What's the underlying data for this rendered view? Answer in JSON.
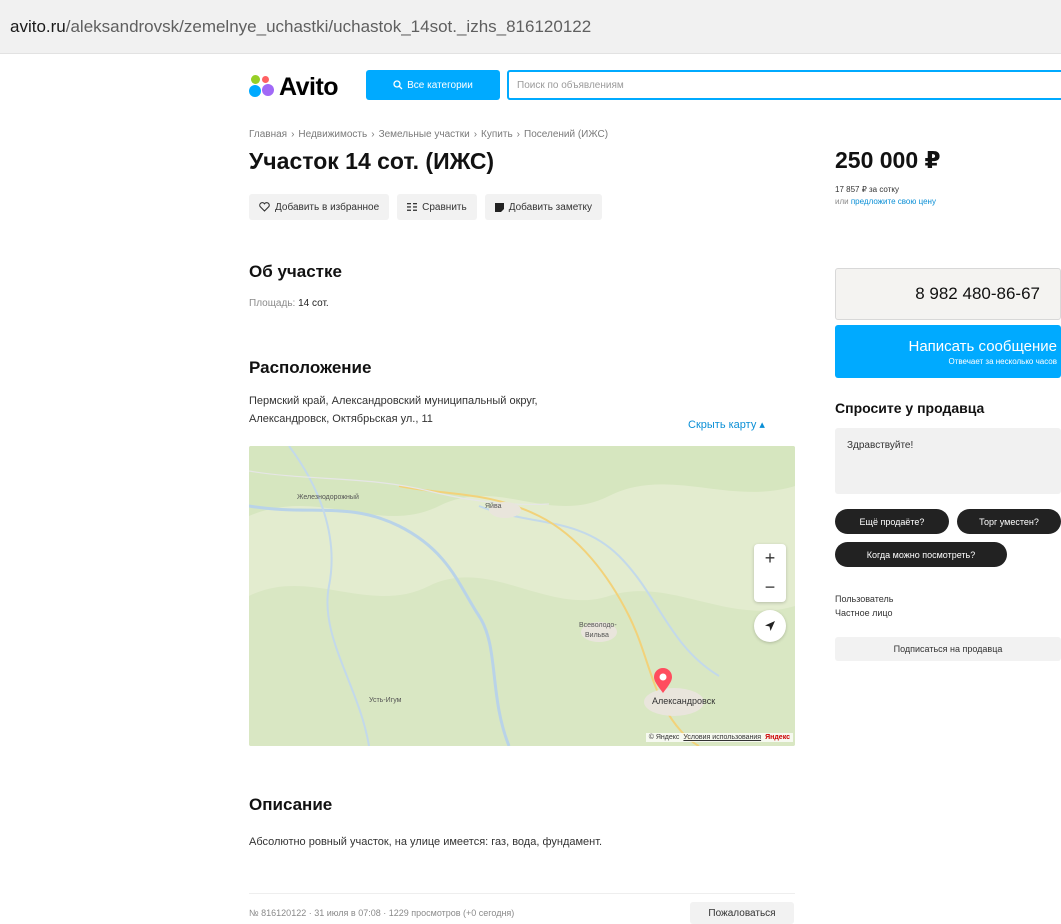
{
  "browser": {
    "url_domain": "avito.ru",
    "url_path": "/aleksandrovsk/zemelnye_uchastki/uchastok_14sot._izhs_816120122"
  },
  "header": {
    "logo_text": "Avito",
    "categories_label": "Все категории",
    "search_placeholder": "Поиск по объявлениям"
  },
  "breadcrumbs": [
    "Главная",
    "›",
    "Недвижимость",
    "›",
    "Земельные участки",
    "›",
    "Купить",
    "›",
    "Поселений (ИЖС)"
  ],
  "listing": {
    "title": "Участок 14 сот. (ИЖС)",
    "actions": {
      "favorite": "Добавить в избранное",
      "compare": "Сравнить",
      "note": "Добавить заметку"
    },
    "about_heading": "Об участке",
    "area_key": "Площадь:",
    "area_value": "14 сот.",
    "location_heading": "Расположение",
    "address_line1": "Пермский край, Александровский муниципальный округ,",
    "address_line2": "Александровск, Октябрьская ул., 11",
    "hide_map": "Скрыть карту ▴",
    "description_heading": "Описание",
    "description": "Абсолютно ровный участок, на улице имеется: газ, вода, фундамент."
  },
  "map": {
    "places": {
      "p1": "Железнодорожный",
      "p2": "Яйва",
      "p3": "Всеволодо-",
      "p3b": "Вильва",
      "p4": "Усть-Игум",
      "p5": "Александровск"
    },
    "zoom_in": "+",
    "zoom_out": "−",
    "copyright": "© Яндекс",
    "terms": "Условия использования",
    "brand": "Яндекс"
  },
  "footer": {
    "meta": "№ 816120122 · 31 июля в 07:08 · 1229 просмотров (+0 сегодня)",
    "complain": "Пожаловаться"
  },
  "sidebar": {
    "price": "250 000 ₽",
    "per_sotka": "17 857 ₽ за сотку",
    "offer_prefix": "или",
    "offer_link": "предложите свою цену",
    "phone": "8 982 480-86-67",
    "message_label": "Написать сообщение",
    "message_sub": "Отвечает за несколько часов",
    "ask_heading": "Спросите у продавца",
    "ask_value": "Здравствуйте!",
    "chips": [
      "Ещё продаёте?",
      "Торг уместен?",
      "Когда можно посмотреть?"
    ],
    "seller_role": "Пользователь",
    "seller_type": "Частное лицо",
    "subscribe": "Подписаться на продавца"
  },
  "colors": {
    "accent": "#00aaff",
    "link": "#0a8fd6",
    "chip_bg": "#222222"
  }
}
